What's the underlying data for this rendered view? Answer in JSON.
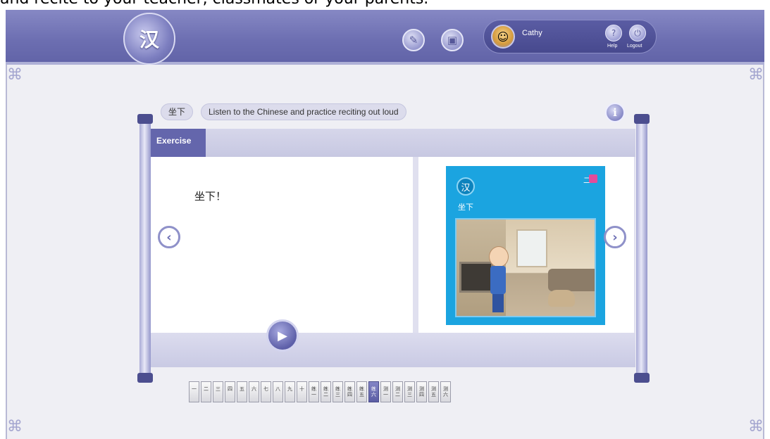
{
  "caption": "and recite to your teacher, classmates or your parents.",
  "header": {
    "logo_glyph": "汉",
    "tools": [
      {
        "name": "pencil-icon",
        "glyph": "✎"
      },
      {
        "name": "notebook-icon",
        "glyph": "▣"
      }
    ],
    "user": {
      "name": "Cathy",
      "avatar_glyph": "☺"
    },
    "help_label": "Help",
    "help_glyph": "?",
    "logout_label": "Logout",
    "logout_glyph": "⏻"
  },
  "exercise": {
    "lesson_tag": "坐下",
    "instruction": "Listen to the Chinese and practice reciting out loud",
    "info_glyph": "i",
    "tab_label": "Exercise",
    "sentence": "坐下！",
    "play_glyph": "▶",
    "prev_glyph": "‹",
    "next_glyph": "›"
  },
  "card": {
    "logo_glyph": "汉",
    "badge": "二",
    "caption": "坐下"
  },
  "lessons": [
    {
      "label": "一",
      "active": false
    },
    {
      "label": "二",
      "active": false
    },
    {
      "label": "三",
      "active": false
    },
    {
      "label": "四",
      "active": false
    },
    {
      "label": "五",
      "active": false
    },
    {
      "label": "六",
      "active": false
    },
    {
      "label": "七",
      "active": false
    },
    {
      "label": "八",
      "active": false
    },
    {
      "label": "九",
      "active": false
    },
    {
      "label": "十",
      "active": false
    },
    {
      "label": "练一",
      "active": false
    },
    {
      "label": "练二",
      "active": false
    },
    {
      "label": "练三",
      "active": false
    },
    {
      "label": "练四",
      "active": false
    },
    {
      "label": "练五",
      "active": false
    },
    {
      "label": "练六",
      "active": true
    },
    {
      "label": "测一",
      "active": false
    },
    {
      "label": "测二",
      "active": false
    },
    {
      "label": "测三",
      "active": false
    },
    {
      "label": "测四",
      "active": false
    },
    {
      "label": "测五",
      "active": false
    },
    {
      "label": "测六",
      "active": false
    }
  ],
  "colors": {
    "header": "#6c6eb1",
    "card": "#1ba4e0",
    "accent": "#6466ac"
  }
}
